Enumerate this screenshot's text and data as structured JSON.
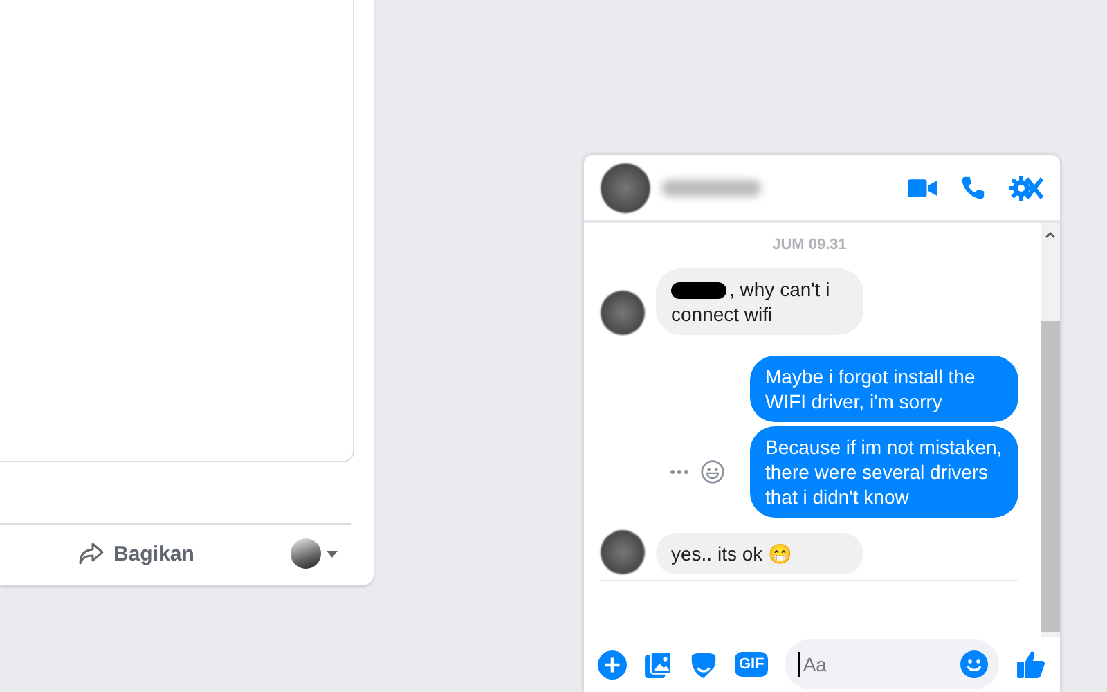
{
  "post_card": {
    "share_label": "Bagikan"
  },
  "chat": {
    "timestamp": "JUM 09.31",
    "messages": [
      {
        "kind": "received",
        "text": ", why can't i connect wifi",
        "redacted_prefix": true
      },
      {
        "kind": "sent",
        "text": "Maybe i forgot install the WIFI driver, i'm sorry",
        "reactions": false
      },
      {
        "kind": "sent",
        "text": "Because if im not mistaken, there were several drivers that i didn't know",
        "reactions": true
      },
      {
        "kind": "received",
        "text": "yes.. its ok 😁",
        "redacted_prefix": false
      }
    ],
    "gif_label": "GIF",
    "placeholder": "Aa"
  }
}
